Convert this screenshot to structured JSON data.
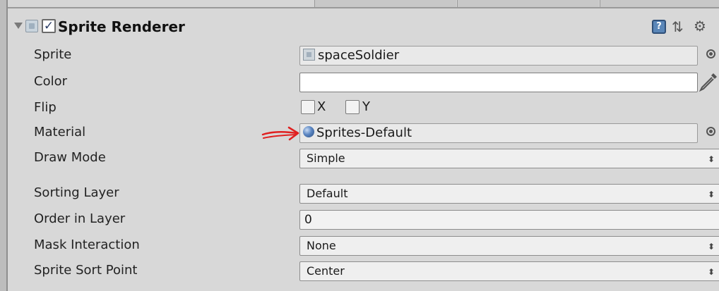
{
  "component": {
    "title": "Sprite Renderer",
    "enabled": true,
    "icons": [
      "fold-arrow-icon",
      "sprite-renderer-icon",
      "help-icon",
      "preset-icon",
      "gear-icon"
    ]
  },
  "properties": {
    "sprite": {
      "label": "Sprite",
      "value": "spaceSoldier"
    },
    "color": {
      "label": "Color",
      "value": "#ffffff"
    },
    "flip": {
      "label": "Flip",
      "x_label": "X",
      "y_label": "Y",
      "x_checked": false,
      "y_checked": false
    },
    "material": {
      "label": "Material",
      "value": "Sprites-Default"
    },
    "draw_mode": {
      "label": "Draw Mode",
      "value": "Simple"
    },
    "sorting_layer": {
      "label": "Sorting Layer",
      "value": "Default"
    },
    "order_in_layer": {
      "label": "Order in Layer",
      "value": "0"
    },
    "mask_interaction": {
      "label": "Mask Interaction",
      "value": "None"
    },
    "sprite_sort_point": {
      "label": "Sprite Sort Point",
      "value": "Center"
    }
  },
  "annotation": {
    "color": "#e02020"
  },
  "colors": {
    "panel": "#d8d8d8",
    "help_icon": "#5a86b8",
    "checkmark": "#2a3d66"
  }
}
